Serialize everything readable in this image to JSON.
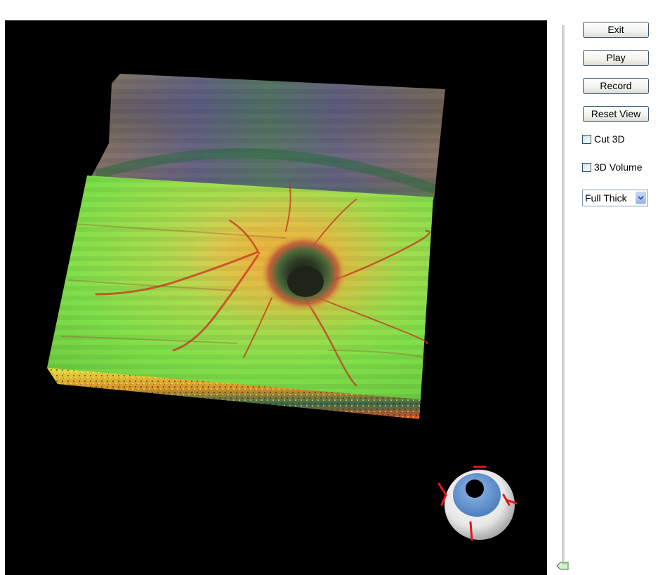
{
  "controls": {
    "exit_label": "Exit",
    "play_label": "Play",
    "record_label": "Record",
    "reset_view_label": "Reset View",
    "cut3d_label": "Cut 3D",
    "cut3d_checked": false,
    "volume3d_label": "3D Volume",
    "volume3d_checked": false,
    "layer_select_value": "Full Thick"
  },
  "viewport": {
    "background": "#000000",
    "surface_colors": {
      "healthy": "#7ee04c",
      "thickened": "#e8c23a",
      "vessel": "#d8321f",
      "depression": "#2a3a28",
      "backwall": "#6b5a45",
      "backwall_blue": "#4a58a0"
    },
    "orientation_widget": {
      "icon": "eyeball-orientation-icon",
      "sclera_color": "#f2f2f2",
      "iris_color": "#6f9ed6",
      "pupil_color": "#000000",
      "axis_color": "#e01818"
    }
  },
  "slider": {
    "orientation": "vertical",
    "value_fraction": 0.0
  }
}
